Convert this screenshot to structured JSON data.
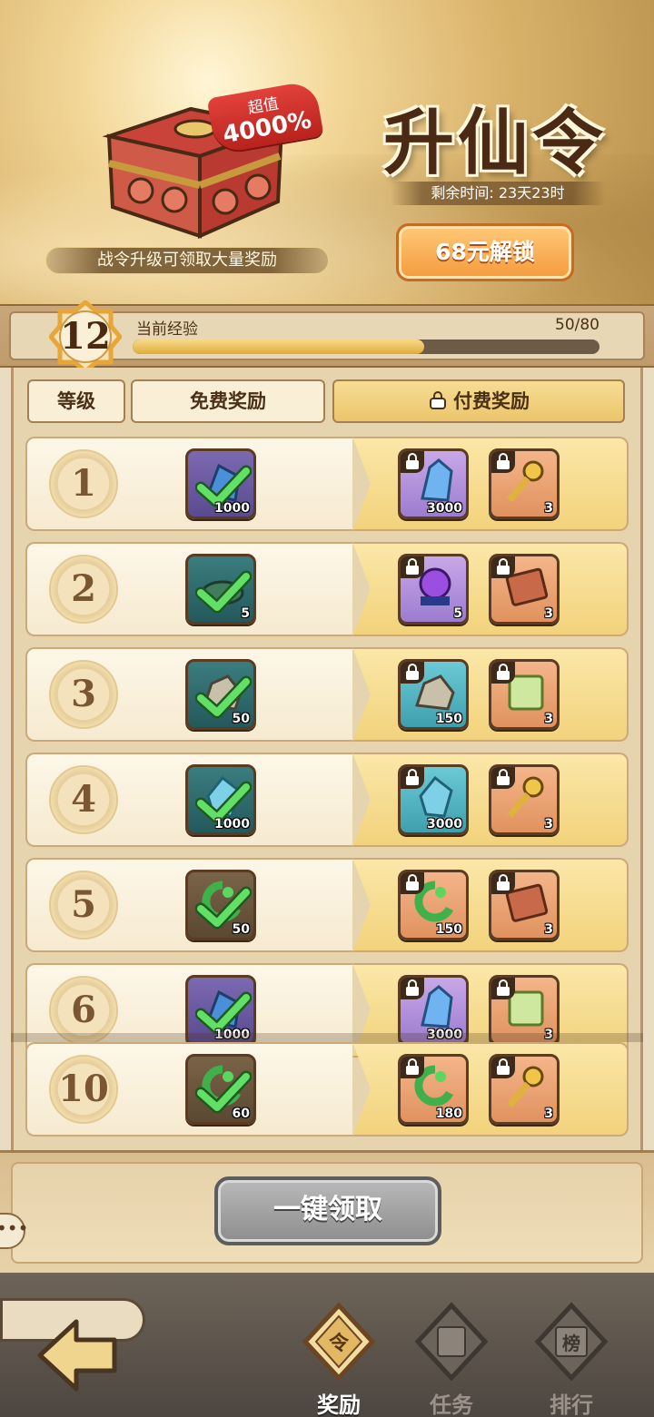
{
  "hero": {
    "value_label": "超值",
    "value_percent": "4000%",
    "caption": "战令升级可领取大量奖励",
    "title": "升仙令",
    "remaining": "剩余时间: 23天23时",
    "unlock_label": "68元解锁"
  },
  "progress": {
    "level": "12",
    "label": "当前经验",
    "value": "50/80",
    "fraction": 0.625
  },
  "headers": {
    "level": "等级",
    "free": "免费奖励",
    "paid": "付费奖励"
  },
  "rows": [
    {
      "level": "1",
      "free": {
        "icon": "crystal-shard-icon",
        "qty": "1000",
        "bg": "purple"
      },
      "paid": [
        {
          "icon": "blue-crystal-icon",
          "qty": "3000",
          "bg": "lilac"
        },
        {
          "icon": "golden-key-icon",
          "qty": "3",
          "bg": "orange"
        }
      ]
    },
    {
      "level": "2",
      "free": {
        "icon": "bowl-icon",
        "qty": "5",
        "bg": "teal"
      },
      "paid": [
        {
          "icon": "purple-orb-icon",
          "qty": "5",
          "bg": "lilac"
        },
        {
          "icon": "scroll-ticket-icon",
          "qty": "3",
          "bg": "orange"
        }
      ]
    },
    {
      "level": "3",
      "free": {
        "icon": "ore-stone-icon",
        "qty": "50",
        "bg": "teal"
      },
      "paid": [
        {
          "icon": "ore-stone-icon",
          "qty": "150",
          "bg": "cyan"
        },
        {
          "icon": "jade-book-icon",
          "qty": "3",
          "bg": "orange"
        }
      ]
    },
    {
      "level": "4",
      "free": {
        "icon": "spirit-crystal-icon",
        "qty": "1000",
        "bg": "teal"
      },
      "paid": [
        {
          "icon": "spirit-crystal-icon",
          "qty": "3000",
          "bg": "cyan"
        },
        {
          "icon": "golden-key-icon",
          "qty": "3",
          "bg": "orange"
        }
      ]
    },
    {
      "level": "5",
      "free": {
        "icon": "jade-dragon-icon",
        "qty": "50",
        "bg": "brown"
      },
      "paid": [
        {
          "icon": "jade-dragon-icon",
          "qty": "150",
          "bg": "orange"
        },
        {
          "icon": "scroll-ticket-icon",
          "qty": "3",
          "bg": "orange"
        }
      ]
    },
    {
      "level": "6",
      "free": {
        "icon": "crystal-shard-icon",
        "qty": "1000",
        "bg": "purple"
      },
      "paid": [
        {
          "icon": "blue-crystal-icon",
          "qty": "3000",
          "bg": "lilac"
        },
        {
          "icon": "jade-book-icon",
          "qty": "3",
          "bg": "orange"
        }
      ]
    },
    {
      "level": "10",
      "free": {
        "icon": "jade-dragon-icon",
        "qty": "60",
        "bg": "brown"
      },
      "paid": [
        {
          "icon": "jade-dragon-icon",
          "qty": "180",
          "bg": "orange"
        },
        {
          "icon": "golden-key-icon",
          "qty": "3",
          "bg": "orange"
        }
      ]
    }
  ],
  "claim_all": "一键领取",
  "chat_icon": "chat-bubble-icon",
  "nav": {
    "reward": "奖励",
    "task": "任务",
    "rank": "排行",
    "reward_emblem": "令",
    "rank_emblem": "榜"
  },
  "colors": {
    "accent_orange": "#f59a3c",
    "check_green": "#55d65a",
    "claim_gray": "#9a9a9a"
  }
}
